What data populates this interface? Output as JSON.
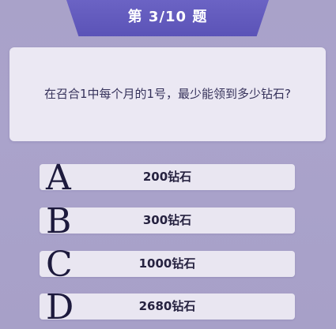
{
  "header": {
    "title": "第 3/10 题"
  },
  "question": {
    "text": "在召合1中每个月的1号，最少能领到多少钻石?"
  },
  "options": [
    {
      "letter": "A",
      "label": "200钻石"
    },
    {
      "letter": "B",
      "label": "300钻石"
    },
    {
      "letter": "C",
      "label": "1000钻石"
    },
    {
      "letter": "D",
      "label": "2680钻石"
    }
  ],
  "colors": {
    "background": "#aaa3cb",
    "header_tab": "#6259be",
    "card": "#ebe8f3",
    "option_bg": "#e9e6f1",
    "letter": "#1d1a3d"
  }
}
